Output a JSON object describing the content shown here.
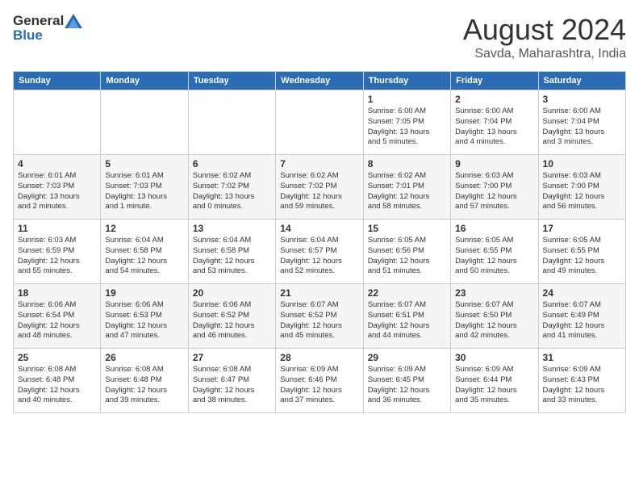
{
  "header": {
    "logo_general": "General",
    "logo_blue": "Blue",
    "month_title": "August 2024",
    "subtitle": "Savda, Maharashtra, India"
  },
  "days_of_week": [
    "Sunday",
    "Monday",
    "Tuesday",
    "Wednesday",
    "Thursday",
    "Friday",
    "Saturday"
  ],
  "weeks": [
    [
      {
        "day": "",
        "info": ""
      },
      {
        "day": "",
        "info": ""
      },
      {
        "day": "",
        "info": ""
      },
      {
        "day": "",
        "info": ""
      },
      {
        "day": "1",
        "info": "Sunrise: 6:00 AM\nSunset: 7:05 PM\nDaylight: 13 hours\nand 5 minutes."
      },
      {
        "day": "2",
        "info": "Sunrise: 6:00 AM\nSunset: 7:04 PM\nDaylight: 13 hours\nand 4 minutes."
      },
      {
        "day": "3",
        "info": "Sunrise: 6:00 AM\nSunset: 7:04 PM\nDaylight: 13 hours\nand 3 minutes."
      }
    ],
    [
      {
        "day": "4",
        "info": "Sunrise: 6:01 AM\nSunset: 7:03 PM\nDaylight: 13 hours\nand 2 minutes."
      },
      {
        "day": "5",
        "info": "Sunrise: 6:01 AM\nSunset: 7:03 PM\nDaylight: 13 hours\nand 1 minute."
      },
      {
        "day": "6",
        "info": "Sunrise: 6:02 AM\nSunset: 7:02 PM\nDaylight: 13 hours\nand 0 minutes."
      },
      {
        "day": "7",
        "info": "Sunrise: 6:02 AM\nSunset: 7:02 PM\nDaylight: 12 hours\nand 59 minutes."
      },
      {
        "day": "8",
        "info": "Sunrise: 6:02 AM\nSunset: 7:01 PM\nDaylight: 12 hours\nand 58 minutes."
      },
      {
        "day": "9",
        "info": "Sunrise: 6:03 AM\nSunset: 7:00 PM\nDaylight: 12 hours\nand 57 minutes."
      },
      {
        "day": "10",
        "info": "Sunrise: 6:03 AM\nSunset: 7:00 PM\nDaylight: 12 hours\nand 56 minutes."
      }
    ],
    [
      {
        "day": "11",
        "info": "Sunrise: 6:03 AM\nSunset: 6:59 PM\nDaylight: 12 hours\nand 55 minutes."
      },
      {
        "day": "12",
        "info": "Sunrise: 6:04 AM\nSunset: 6:58 PM\nDaylight: 12 hours\nand 54 minutes."
      },
      {
        "day": "13",
        "info": "Sunrise: 6:04 AM\nSunset: 6:58 PM\nDaylight: 12 hours\nand 53 minutes."
      },
      {
        "day": "14",
        "info": "Sunrise: 6:04 AM\nSunset: 6:57 PM\nDaylight: 12 hours\nand 52 minutes."
      },
      {
        "day": "15",
        "info": "Sunrise: 6:05 AM\nSunset: 6:56 PM\nDaylight: 12 hours\nand 51 minutes."
      },
      {
        "day": "16",
        "info": "Sunrise: 6:05 AM\nSunset: 6:55 PM\nDaylight: 12 hours\nand 50 minutes."
      },
      {
        "day": "17",
        "info": "Sunrise: 6:05 AM\nSunset: 6:55 PM\nDaylight: 12 hours\nand 49 minutes."
      }
    ],
    [
      {
        "day": "18",
        "info": "Sunrise: 6:06 AM\nSunset: 6:54 PM\nDaylight: 12 hours\nand 48 minutes."
      },
      {
        "day": "19",
        "info": "Sunrise: 6:06 AM\nSunset: 6:53 PM\nDaylight: 12 hours\nand 47 minutes."
      },
      {
        "day": "20",
        "info": "Sunrise: 6:06 AM\nSunset: 6:52 PM\nDaylight: 12 hours\nand 46 minutes."
      },
      {
        "day": "21",
        "info": "Sunrise: 6:07 AM\nSunset: 6:52 PM\nDaylight: 12 hours\nand 45 minutes."
      },
      {
        "day": "22",
        "info": "Sunrise: 6:07 AM\nSunset: 6:51 PM\nDaylight: 12 hours\nand 44 minutes."
      },
      {
        "day": "23",
        "info": "Sunrise: 6:07 AM\nSunset: 6:50 PM\nDaylight: 12 hours\nand 42 minutes."
      },
      {
        "day": "24",
        "info": "Sunrise: 6:07 AM\nSunset: 6:49 PM\nDaylight: 12 hours\nand 41 minutes."
      }
    ],
    [
      {
        "day": "25",
        "info": "Sunrise: 6:08 AM\nSunset: 6:48 PM\nDaylight: 12 hours\nand 40 minutes."
      },
      {
        "day": "26",
        "info": "Sunrise: 6:08 AM\nSunset: 6:48 PM\nDaylight: 12 hours\nand 39 minutes."
      },
      {
        "day": "27",
        "info": "Sunrise: 6:08 AM\nSunset: 6:47 PM\nDaylight: 12 hours\nand 38 minutes."
      },
      {
        "day": "28",
        "info": "Sunrise: 6:09 AM\nSunset: 6:46 PM\nDaylight: 12 hours\nand 37 minutes."
      },
      {
        "day": "29",
        "info": "Sunrise: 6:09 AM\nSunset: 6:45 PM\nDaylight: 12 hours\nand 36 minutes."
      },
      {
        "day": "30",
        "info": "Sunrise: 6:09 AM\nSunset: 6:44 PM\nDaylight: 12 hours\nand 35 minutes."
      },
      {
        "day": "31",
        "info": "Sunrise: 6:09 AM\nSunset: 6:43 PM\nDaylight: 12 hours\nand 33 minutes."
      }
    ]
  ]
}
